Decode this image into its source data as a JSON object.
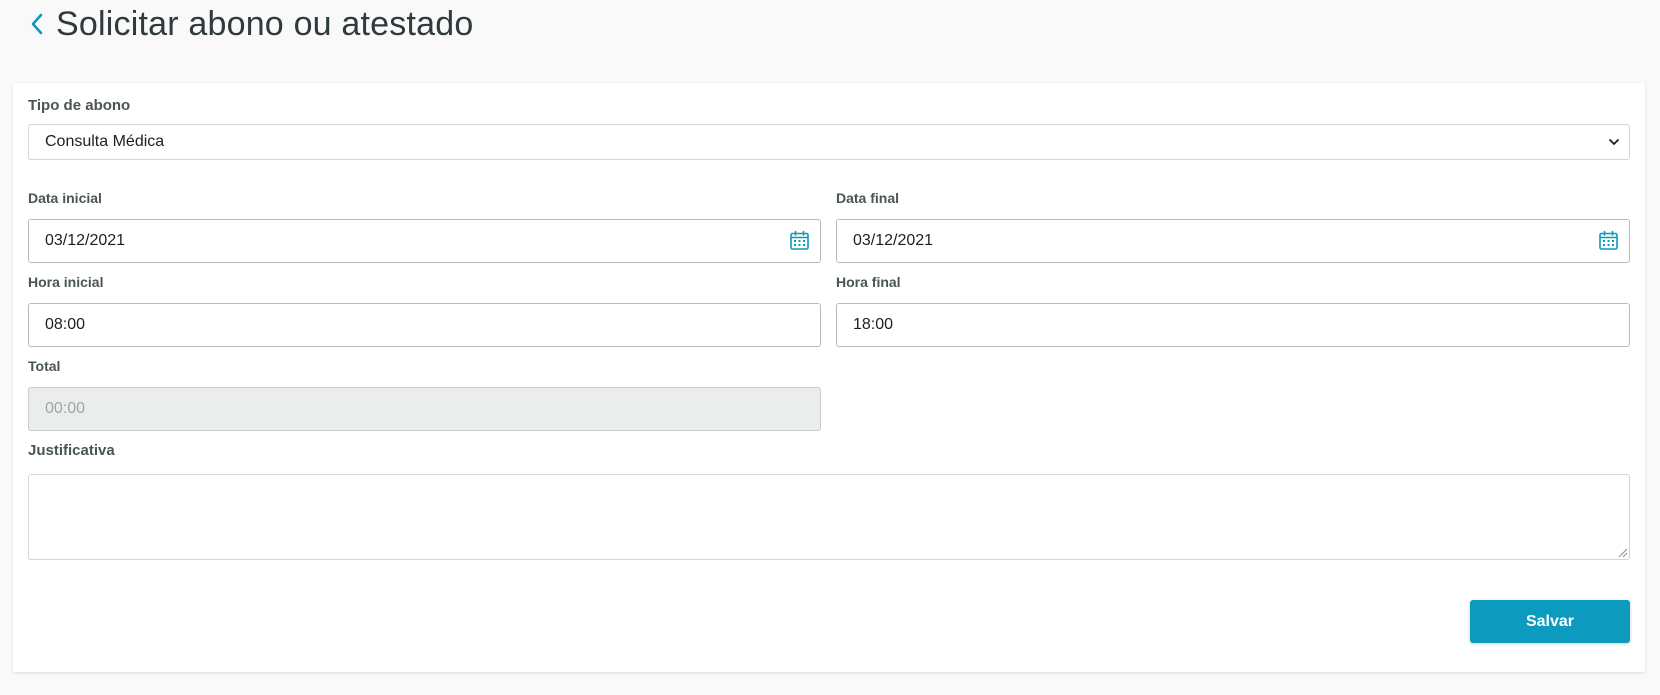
{
  "header": {
    "title": "Solicitar abono ou atestado"
  },
  "form": {
    "tipo_abono": {
      "label": "Tipo de abono",
      "value": "Consulta Médica"
    },
    "data_inicial": {
      "label": "Data inicial",
      "value": "03/12/2021"
    },
    "data_final": {
      "label": "Data final",
      "value": "03/12/2021"
    },
    "hora_inicial": {
      "label": "Hora inicial",
      "value": "08:00"
    },
    "hora_final": {
      "label": "Hora final",
      "value": "18:00"
    },
    "total": {
      "label": "Total",
      "value": "00:00"
    },
    "justificativa": {
      "label": "Justificativa",
      "value": ""
    },
    "save_label": "Salvar"
  },
  "icons": {
    "back": "chevron-left-icon",
    "select": "chevron-down-icon",
    "calendar": "calendar-icon",
    "resize": "resize-handle-icon"
  },
  "colors": {
    "accent": "#0c9abe",
    "title": "#2f3a3d",
    "disabled_bg": "#ebeded"
  }
}
